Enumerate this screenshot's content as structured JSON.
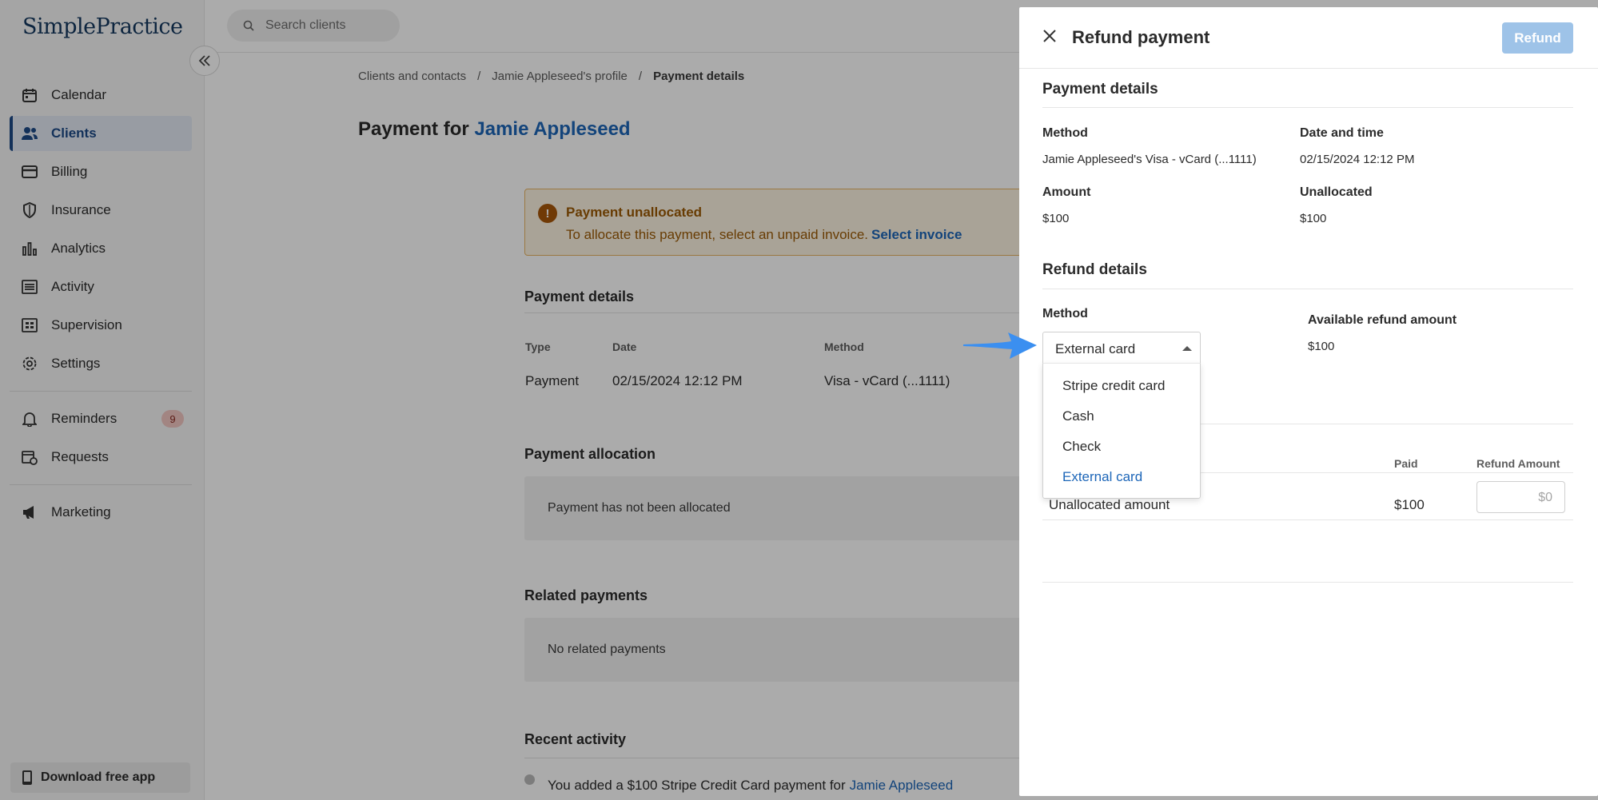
{
  "app": {
    "brand": "SimplePractice"
  },
  "sidebar": {
    "items": [
      {
        "label": "Calendar",
        "icon": "calendar-icon"
      },
      {
        "label": "Clients",
        "icon": "clients-icon",
        "active": true
      },
      {
        "label": "Billing",
        "icon": "billing-icon"
      },
      {
        "label": "Insurance",
        "icon": "shield-icon"
      },
      {
        "label": "Analytics",
        "icon": "analytics-icon"
      },
      {
        "label": "Activity",
        "icon": "activity-icon"
      },
      {
        "label": "Supervision",
        "icon": "supervision-icon"
      },
      {
        "label": "Settings",
        "icon": "gear-icon"
      }
    ],
    "secondary": [
      {
        "label": "Reminders",
        "icon": "bell-icon",
        "badge": "9"
      },
      {
        "label": "Requests",
        "icon": "requests-icon"
      }
    ],
    "tertiary": [
      {
        "label": "Marketing",
        "icon": "megaphone-icon"
      }
    ],
    "download_label": "Download free app"
  },
  "search": {
    "placeholder": "Search clients"
  },
  "breadcrumb": {
    "items": [
      "Clients and contacts",
      "Jamie Appleseed's profile"
    ],
    "current": "Payment details",
    "separator": "/"
  },
  "page": {
    "title_prefix": "Payment for",
    "client_name": "Jamie Appleseed"
  },
  "alert": {
    "title": "Payment unallocated",
    "message": "To allocate this payment, select an unpaid invoice.",
    "link": "Select invoice",
    "icon": "!"
  },
  "payment_details": {
    "title": "Payment details",
    "headers": [
      "Type",
      "Date",
      "Method"
    ],
    "row": [
      "Payment",
      "02/15/2024 12:12 PM",
      "Visa - vCard (...1111)"
    ]
  },
  "payment_allocation": {
    "title": "Payment allocation",
    "empty": "Payment has not been allocated"
  },
  "related_payments": {
    "title": "Related payments",
    "empty": "No related payments"
  },
  "recent_activity": {
    "title": "Recent activity",
    "entry": "You added a $100 Stripe Credit Card payment for",
    "entry_link": "Jamie Appleseed"
  },
  "drawer": {
    "title": "Refund payment",
    "refund_button": "Refund",
    "payment_details": {
      "title": "Payment details",
      "method_label": "Method",
      "method_value": "Jamie Appleseed's Visa - vCard (...1111)",
      "date_label": "Date and time",
      "date_value": "02/15/2024 12:12 PM",
      "amount_label": "Amount",
      "amount_value": "$100",
      "unallocated_label": "Unallocated",
      "unallocated_value": "$100"
    },
    "refund_details": {
      "title": "Refund details",
      "method_label": "Method",
      "method_selected": "External card",
      "method_options": [
        "Stripe credit card",
        "Cash",
        "Check",
        "External card"
      ],
      "available_label": "Available refund amount",
      "available_value": "$100"
    },
    "table": {
      "headers": {
        "paid": "Paid",
        "refund_amount": "Refund Amount"
      },
      "row": {
        "label": "Unallocated amount",
        "paid": "$100",
        "refund_placeholder": "$0"
      }
    }
  },
  "colors": {
    "accent": "#1d66b8",
    "brand": "#14385f",
    "alert_bg": "#fdf3e2",
    "alert_text": "#9b5a05",
    "refund_button": "#9ec3e8",
    "pointer_arrow": "#3b8ff0"
  }
}
